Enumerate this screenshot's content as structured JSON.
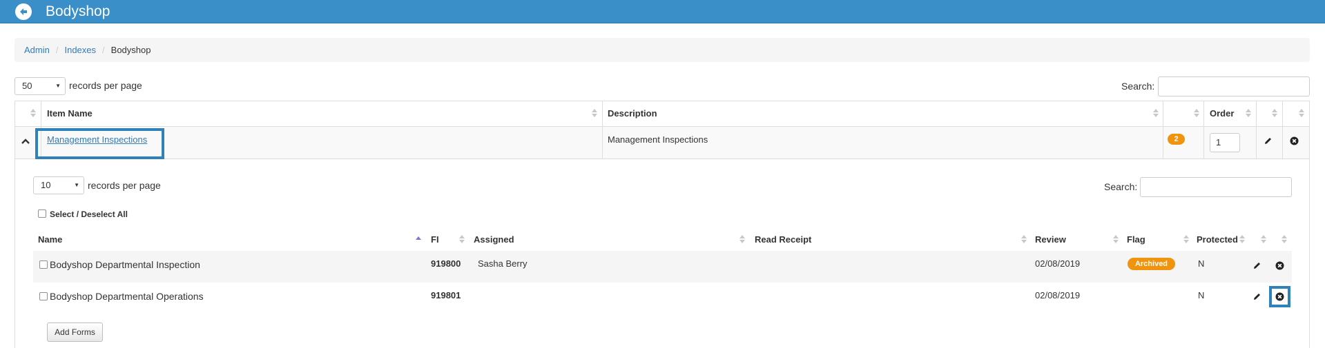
{
  "header": {
    "title": "Bodyshop",
    "colors": {
      "bar": "#3a8fc9",
      "accent_highlight": "#2f82b9",
      "badge": "#f0930e"
    }
  },
  "breadcrumb": {
    "items": [
      "Admin",
      "Indexes"
    ],
    "current": "Bodyshop"
  },
  "outer": {
    "page_size": "50",
    "records_label": "records per page",
    "search_label": "Search:",
    "search_value": "",
    "columns": [
      "Item Name",
      "Description",
      "",
      "Order",
      "",
      ""
    ],
    "rows": [
      {
        "item_name": "Management Inspections",
        "description": "Management Inspections",
        "count_badge": "2",
        "order": "1"
      }
    ]
  },
  "inner": {
    "page_size": "10",
    "records_label": "records per page",
    "search_label": "Search:",
    "search_value": "",
    "select_all_label": "Select / Deselect All",
    "columns": [
      "Name",
      "FI",
      "Assigned",
      "Read Receipt",
      "Review",
      "Flag",
      "Protected"
    ],
    "rows": [
      {
        "name": "Bodyshop Departmental Inspection",
        "fi": "919800",
        "assigned": "Sasha Berry",
        "read_receipt": "",
        "review": "02/08/2019",
        "flag": "Archived",
        "protected": "N"
      },
      {
        "name": "Bodyshop Departmental Operations",
        "fi": "919801",
        "assigned": "",
        "read_receipt": "",
        "review": "02/08/2019",
        "flag": "",
        "protected": "N"
      }
    ],
    "add_button": "Add Forms"
  },
  "icons": [
    "back-arrow-icon",
    "collapse-chevron-icon",
    "pencil-icon",
    "remove-circle-icon",
    "dropdown-caret-icon",
    "sort-arrows-icon"
  ]
}
